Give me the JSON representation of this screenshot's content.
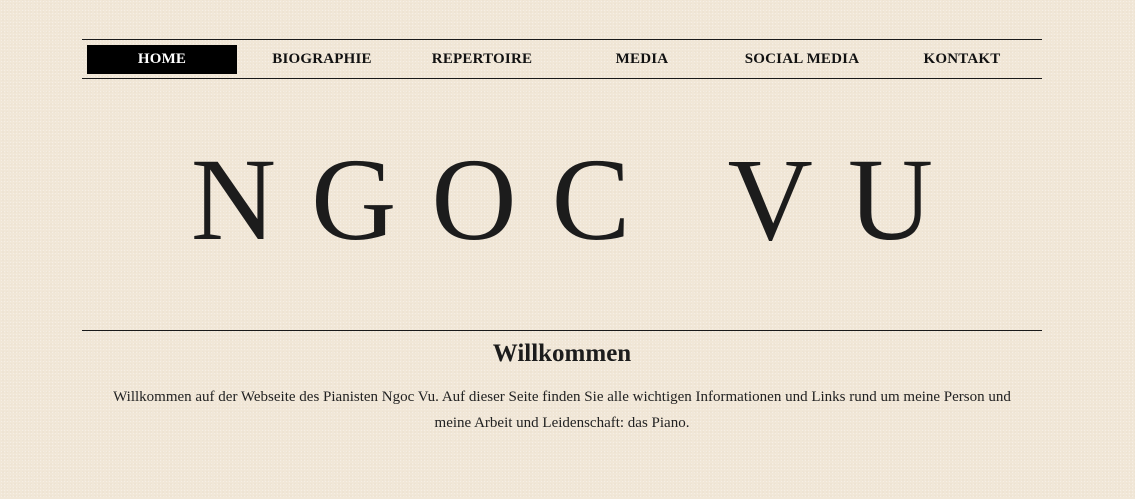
{
  "nav": {
    "items": [
      {
        "label": "HOME",
        "active": true
      },
      {
        "label": "BIOGRAPHIE",
        "active": false
      },
      {
        "label": "REPERTOIRE",
        "active": false
      },
      {
        "label": "MEDIA",
        "active": false
      },
      {
        "label": "SOCIAL MEDIA",
        "active": false
      },
      {
        "label": "KONTAKT",
        "active": false
      }
    ]
  },
  "hero": {
    "title": "NGOC VU"
  },
  "welcome": {
    "heading": "Willkommen",
    "text": "Willkommen auf der Webseite des Pianisten Ngoc Vu. Auf dieser Seite finden Sie alle wichtigen Informationen und Links rund um meine Person und meine Arbeit und Leidenschaft: das Piano."
  },
  "colors": {
    "background": "#f1e7d7",
    "text": "#1c1c1c",
    "nav_active_bg": "#000000",
    "nav_active_text": "#ffffff"
  }
}
